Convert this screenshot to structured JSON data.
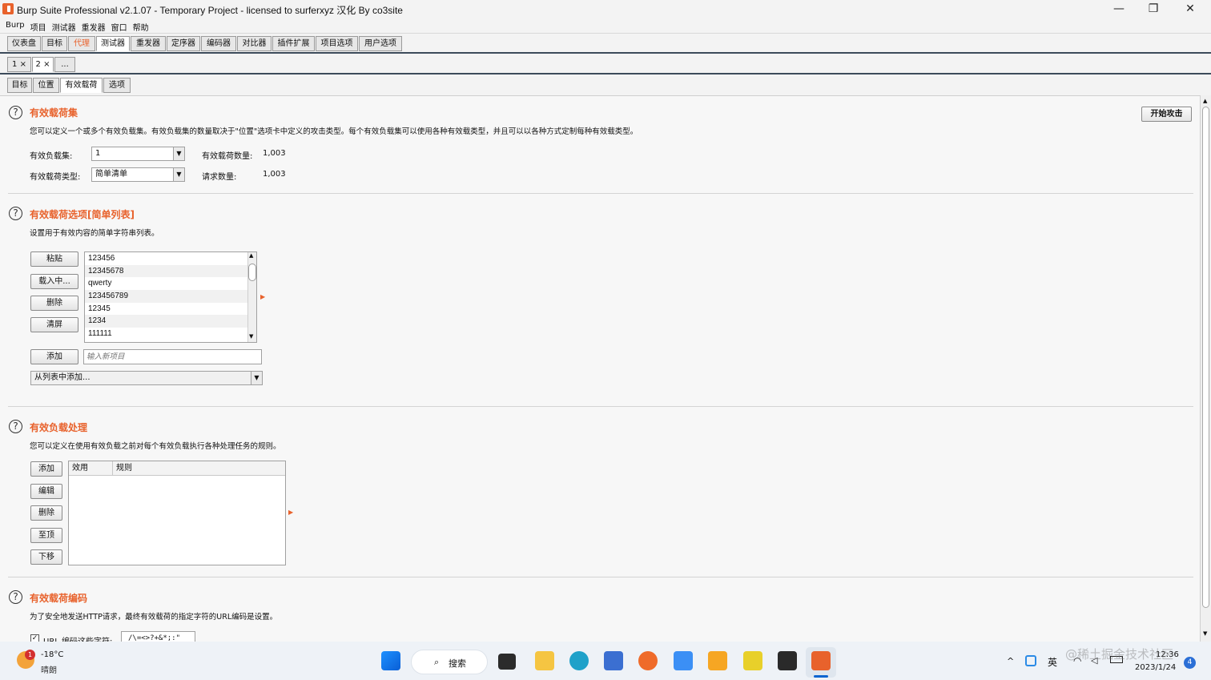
{
  "window": {
    "title": "Burp Suite Professional v2.1.07 - Temporary Project - licensed to surferxyz 汉化 By co3site",
    "minimize": "—",
    "maximize": "❐",
    "close": "✕"
  },
  "menu": [
    "Burp",
    "项目",
    "测试器",
    "重发器",
    "窗口",
    "帮助"
  ],
  "main_tabs": [
    "仪表盘",
    "目标",
    "代理",
    "测试器",
    "重发器",
    "定序器",
    "编码器",
    "对比器",
    "插件扩展",
    "项目选项",
    "用户选项"
  ],
  "instance_tabs": [
    "1 ×",
    "2 ×",
    "..."
  ],
  "sub_tabs": [
    "目标",
    "位置",
    "有效载荷",
    "选项"
  ],
  "start_attack": "开始攻击",
  "payload_sets": {
    "title": "有效载荷集",
    "description": "您可以定义一个或多个有效负载集。有效负载集的数量取决于\"位置\"选项卡中定义的攻击类型。每个有效负载集可以使用各种有效载类型，并且可以以各种方式定制每种有效载类型。",
    "set_label": "有效负载集:",
    "set_value": "1",
    "type_label": "有效载荷类型:",
    "type_value": "简单清单",
    "count_label": "有效载荷数量:",
    "count_value": "1,003",
    "req_label": "请求数量:",
    "req_value": "1,003"
  },
  "payload_options": {
    "title": "有效载荷选项[简单列表]",
    "description": "设置用于有效内容的简单字符串列表。",
    "buttons": [
      "粘贴",
      "载入中...",
      "删除",
      "清屏"
    ],
    "items": [
      "123456",
      "12345678",
      "qwerty",
      "123456789",
      "12345",
      "1234",
      "111111"
    ],
    "add": "添加",
    "add_placeholder": "输入新项目",
    "add_from_list": "从列表中添加..."
  },
  "payload_processing": {
    "title": "有效负载处理",
    "description": "您可以定义在使用有效负载之前对每个有效负载执行各种处理任务的规则。",
    "buttons": [
      "添加",
      "编辑",
      "删除",
      "至顶",
      "下移"
    ],
    "columns": [
      "效用",
      "规则"
    ]
  },
  "payload_encoding": {
    "title": "有效载荷编码",
    "description": "为了安全地发送HTTP请求，最终有效载荷的指定字符的URL编码是设置。",
    "checkbox": "URL 编码这些字符:",
    "chars": "/\\=<>?+&*;:\"{}|^`"
  },
  "taskbar": {
    "weather_temp": "-18°C",
    "weather_desc": "晴朗",
    "search": "搜索",
    "lang": "英",
    "time": "12:36",
    "date": "2023/1/24",
    "badge": "4",
    "watermark": "@稀土掘金技术社区"
  }
}
